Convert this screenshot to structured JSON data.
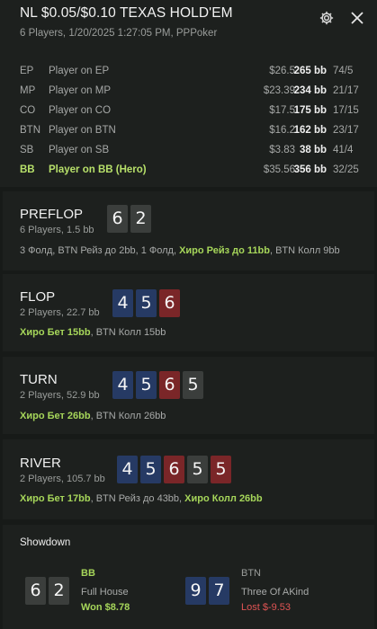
{
  "header": {
    "title": "NL $0.05/$0.10 TEXAS HOLD'EM",
    "subtitle": "6 Players, 1/20/2025 1:27:05 PM, PPPoker",
    "icons": [
      "gear-icon",
      "close-icon"
    ]
  },
  "players": [
    {
      "pos": "EP",
      "name": "Player on EP",
      "stack": "$26.5",
      "bb": "265 bb",
      "ratio": "74/5"
    },
    {
      "pos": "MP",
      "name": "Player on MP",
      "stack": "$23.39",
      "bb": "234 bb",
      "ratio": "21/17"
    },
    {
      "pos": "CO",
      "name": "Player on CO",
      "stack": "$17.5",
      "bb": "175 bb",
      "ratio": "17/15"
    },
    {
      "pos": "BTN",
      "name": "Player on BTN",
      "stack": "$16.2",
      "bb": "162 bb",
      "ratio": "23/17"
    },
    {
      "pos": "SB",
      "name": "Player on SB",
      "stack": "$3.83",
      "bb": "38 bb",
      "ratio": "41/4"
    },
    {
      "pos": "BB",
      "name": "Player on BB (Hero)",
      "stack": "$35.56",
      "bb": "356 bb",
      "ratio": "32/25",
      "hero": true
    }
  ],
  "streets": {
    "preflop": {
      "name": "PREFLOP",
      "sub": "6 Players, 1.5 bb",
      "cards": [
        "6",
        "2"
      ],
      "a1": "3 Фолд, BTN Рейз до 2bb, 1 Фолд, ",
      "a2": "Хиро Рейз до 11bb",
      "a3": ", BTN Колл 9bb"
    },
    "flop": {
      "name": "FLOP",
      "sub": "2 Players, 22.7 bb",
      "cards": [
        "4",
        "5",
        "6"
      ],
      "a1": "Хиро Бет 15bb",
      "a2": ", BTN Колл 15bb"
    },
    "turn": {
      "name": "TURN",
      "sub": "2 Players, 52.9 bb",
      "cards": [
        "4",
        "5",
        "6",
        "5"
      ],
      "a1": "Хиро Бет 26bb",
      "a2": ", BTN Колл 26bb"
    },
    "river": {
      "name": "RIVER",
      "sub": "2 Players, 105.7 bb",
      "cards": [
        "4",
        "5",
        "6",
        "5",
        "5"
      ],
      "a1": "Хиро Бет 17bb",
      "a2": ", BTN Рейз до 43bb, ",
      "a3": "Хиро Колл 26bb"
    }
  },
  "showdown": {
    "title": "Showdown",
    "hero": {
      "cards": [
        "6",
        "2"
      ],
      "pos": "BB",
      "hand": "Full House",
      "result": "Won $8.78"
    },
    "villain": {
      "cards": [
        "9",
        "7"
      ],
      "pos": "BTN",
      "hand": "Three Of AKind",
      "result": "Lost $-9.53"
    }
  },
  "colors": {
    "background": "#171a18",
    "panel": "#1d201e",
    "hero_green": "#a6d65a",
    "loss_red": "#e05454",
    "card_blue": "#263a64",
    "card_red": "#7a2628",
    "card_black": "#3b3e3c"
  }
}
